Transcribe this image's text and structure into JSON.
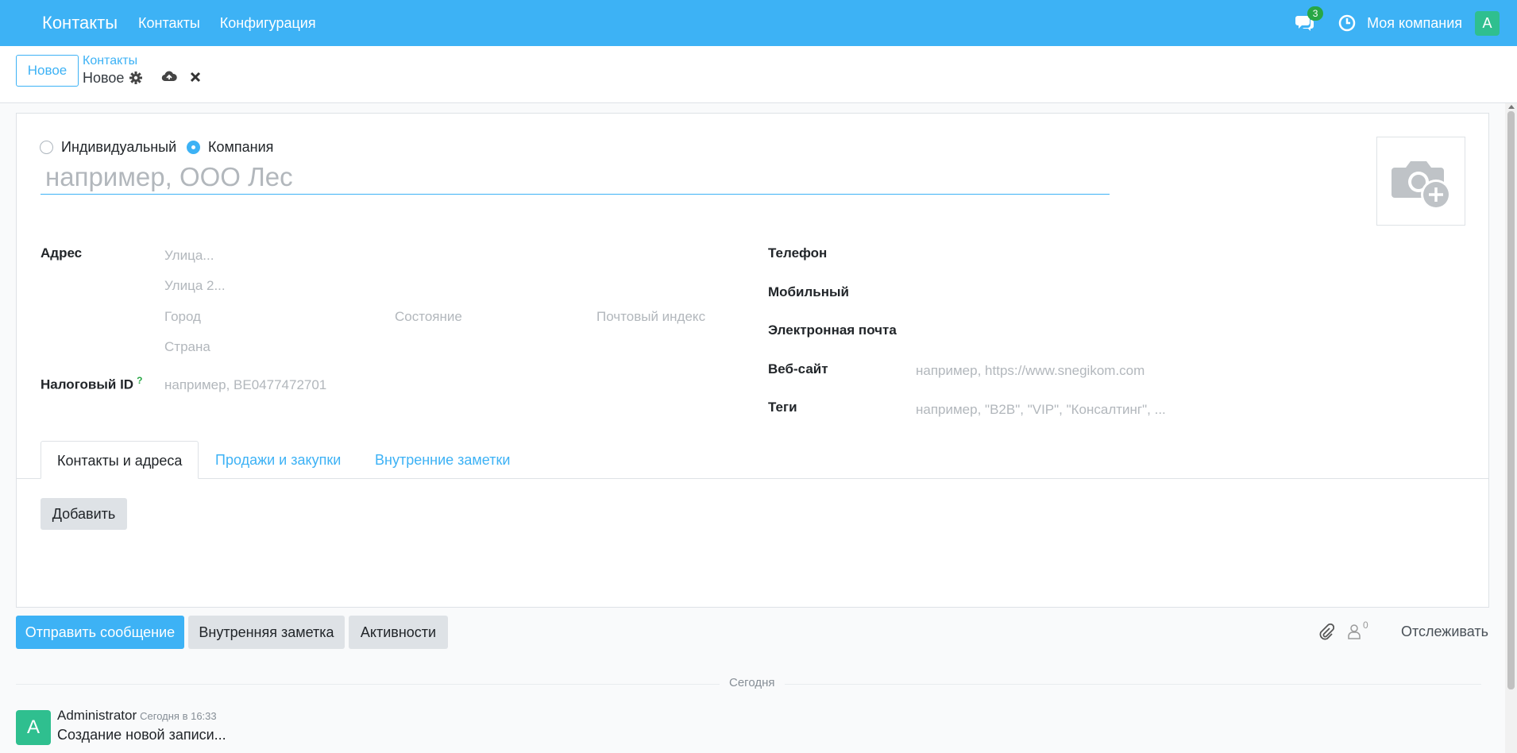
{
  "navbar": {
    "brand": "Контакты",
    "menu": [
      "Контакты",
      "Конфигурация"
    ],
    "chat_count": "3",
    "company": "Моя компания",
    "avatar_letter": "A"
  },
  "control_panel": {
    "new_button": "Новое",
    "breadcrumb_parent": "Контакты",
    "breadcrumb_current": "Новое"
  },
  "form": {
    "company_type": {
      "individual_label": "Индивидуальный",
      "company_label": "Компания",
      "selected": "Компания"
    },
    "name_placeholder": "например, ООО Лес",
    "address": {
      "label": "Адрес",
      "street_placeholder": "Улица...",
      "street2_placeholder": "Улица 2...",
      "city_placeholder": "Город",
      "state_placeholder": "Состояние",
      "zip_placeholder": "Почтовый индекс",
      "country_placeholder": "Страна"
    },
    "tax_id": {
      "label": "Налоговый ID",
      "tooltip": "?",
      "placeholder": "например, BE0477472701"
    },
    "phone_label": "Телефон",
    "mobile_label": "Мобильный",
    "email_label": "Электронная почта",
    "website": {
      "label": "Веб-сайт",
      "placeholder": "например, https://www.snegikom.com"
    },
    "tags": {
      "label": "Теги",
      "placeholder": "например, \"B2B\", \"VIP\", \"Консалтинг\", ..."
    }
  },
  "tabs": [
    {
      "label": "Контакты и адреса",
      "active": true
    },
    {
      "label": "Продажи и закупки",
      "active": false
    },
    {
      "label": "Внутренние заметки",
      "active": false
    }
  ],
  "add_button": "Добавить",
  "chatter": {
    "send_message": "Отправить сообщение",
    "log_note": "Внутренняя заметка",
    "activities": "Активности",
    "followers_count": "0",
    "follow": "Отслеживать",
    "date_separator": "Сегодня",
    "message": {
      "avatar_letter": "A",
      "author": "Administrator",
      "time": "Сегодня в 16:33",
      "body": "Создание новой записи..."
    }
  },
  "colors": {
    "primary": "#3db2f5",
    "avatar": "#2fbf8f",
    "badge": "#28a745"
  }
}
